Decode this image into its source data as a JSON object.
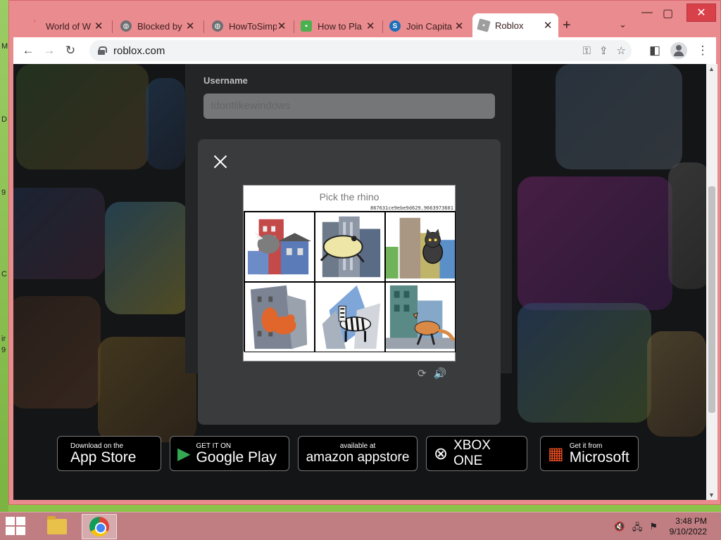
{
  "desktop": {
    "edge_glyphs": [
      "M",
      "D",
      "9",
      "C",
      "ir",
      "9"
    ]
  },
  "browser": {
    "tabs": [
      {
        "label": "World of W",
        "icon": "wow-icon",
        "color": "#d04a7a"
      },
      {
        "label": "Blocked by",
        "icon": "globe-icon",
        "color": "#5f6368"
      },
      {
        "label": "HowToSimp",
        "icon": "globe-icon",
        "color": "#5f6368"
      },
      {
        "label": "How to Pla",
        "icon": "game-icon",
        "color": "#4caf50"
      },
      {
        "label": "Join Capita",
        "icon": "s-logo-icon",
        "color": "#1e6fb8"
      },
      {
        "label": "Roblox",
        "icon": "roblox-icon",
        "color": "#9e9e9e"
      }
    ],
    "active_tab": 5,
    "new_tab_symbol": "+",
    "tab_menu_symbol": "⌄",
    "window_controls": {
      "minimize": "—",
      "maximize": "▢",
      "close": "✕"
    },
    "url": "roblox.com"
  },
  "page": {
    "username_label": "Username",
    "username_value": "Idontlikewindows"
  },
  "captcha": {
    "title": "Pick the rhino",
    "challenge_id": "867631ce9ebe9d629.9663973601",
    "cells": [
      {
        "animal": "rhino",
        "animal_color": "#7d7d7d"
      },
      {
        "animal": "frog",
        "animal_color": "#ede6a6"
      },
      {
        "animal": "cat",
        "animal_color": "#3c3c3c"
      },
      {
        "animal": "squirrel",
        "animal_color": "#e0662b"
      },
      {
        "animal": "zebra",
        "animal_color": "#f2f2f2"
      },
      {
        "animal": "kangaroo",
        "animal_color": "#d98a47"
      }
    ],
    "reload_symbol": "⟳",
    "audio_symbol": "🔊"
  },
  "badges": [
    {
      "icon": "apple-icon",
      "glyph": "",
      "small": "Download on the",
      "big": "App Store"
    },
    {
      "icon": "play-icon",
      "glyph": "▶",
      "small": "GET IT ON",
      "big": "Google Play"
    },
    {
      "icon": "amazon-icon",
      "glyph": "",
      "small": "available at",
      "big": "amazon appstore"
    },
    {
      "icon": "xbox-icon",
      "glyph": "⊗",
      "small": "",
      "big": "XBOX ONE"
    },
    {
      "icon": "microsoft-icon",
      "glyph": "▦",
      "small": "Get it from",
      "big": "Microsoft"
    }
  ],
  "taskbar": {
    "time": "3:48 PM",
    "date": "9/10/2022"
  }
}
